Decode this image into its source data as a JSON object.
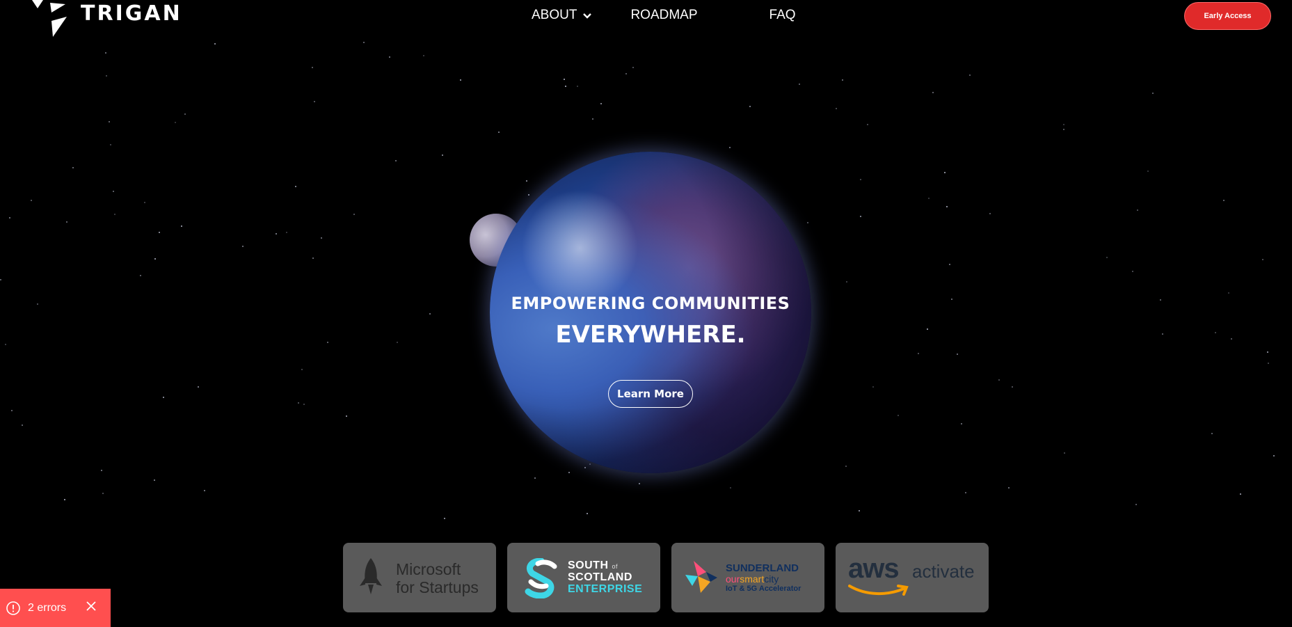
{
  "header": {
    "logo_text": "TRIGAN",
    "nav": [
      {
        "label": "ABOUT",
        "has_dropdown": true
      },
      {
        "label": "ROADMAP"
      },
      {
        "label": "FAQ"
      }
    ],
    "cta_label": "Early Access"
  },
  "hero": {
    "subtitle": "EMPOWERING COMMUNITIES",
    "title": "EVERYWHERE.",
    "button_label": "Learn More"
  },
  "partners": {
    "microsoft": {
      "line1": "Microsoft",
      "line2": "for Startups"
    },
    "scotland": {
      "line1": "SOUTH",
      "of": "of",
      "line2": "SCOTLAND",
      "line3": "ENTERPRISE"
    },
    "sunderland": {
      "line1": "SUNDERLAND",
      "line2_a": "our",
      "line2_b": "smart",
      "line2_c": "city",
      "line3": "IoT & 5G Accelerator"
    },
    "aws": {
      "logo": "aws",
      "text": "activate"
    }
  },
  "toast": {
    "text": "2 errors"
  },
  "colors": {
    "cta": "#e02a2a",
    "toast": "#ff4f4f",
    "card": "#5a5a5a"
  }
}
